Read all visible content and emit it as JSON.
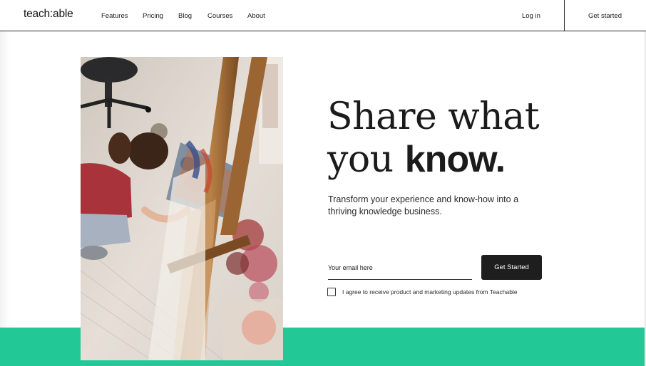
{
  "header": {
    "logo": "teach:able",
    "nav": [
      {
        "label": "Features"
      },
      {
        "label": "Pricing"
      },
      {
        "label": "Blog"
      },
      {
        "label": "Courses"
      },
      {
        "label": "About"
      }
    ],
    "login_label": "Log in",
    "get_started_label": "Get started"
  },
  "hero": {
    "headline_line1": "Share what",
    "headline_line2_serif": "you",
    "headline_line2_bold": "know.",
    "subtext": "Transform your experience and know-how into a thriving knowledge business.",
    "email_placeholder": "Your email here",
    "cta_label": "Get Started",
    "consent_label": "I agree to receive product and marketing updates from Teachable",
    "consent_checked": false
  },
  "colors": {
    "accent_green": "#22c997",
    "button_dark": "#1e1e1e",
    "text": "#1b1b1b"
  }
}
